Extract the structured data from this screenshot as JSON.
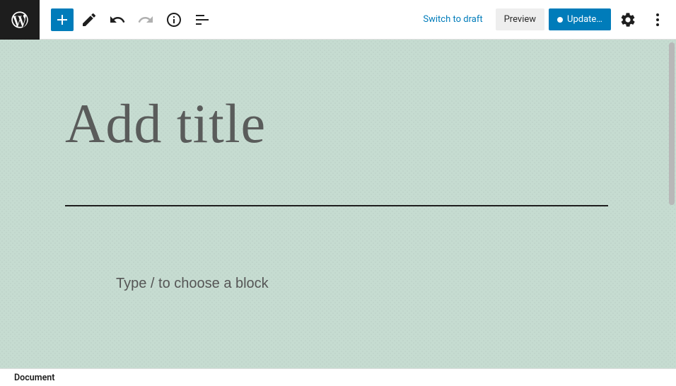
{
  "toolbar": {
    "switch_label": "Switch to draft",
    "preview_label": "Preview",
    "update_label": "Update…"
  },
  "editor": {
    "title_placeholder": "Add title",
    "title_value": "",
    "block_placeholder": "Type / to choose a block",
    "block_value": ""
  },
  "footer": {
    "breadcrumb": "Document"
  },
  "colors": {
    "primary": "#007cba",
    "canvas_bg": "#c6dcd1"
  }
}
